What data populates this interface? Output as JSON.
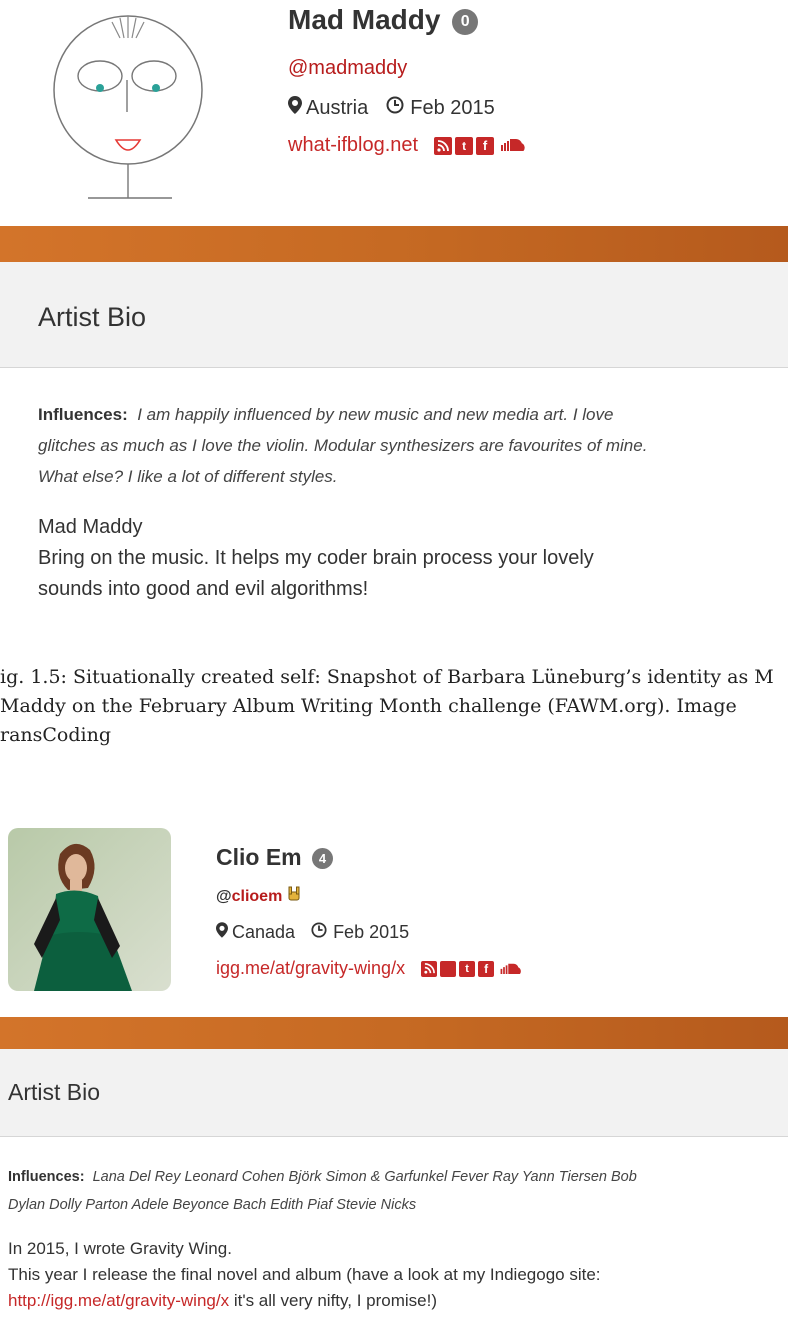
{
  "profile1": {
    "name": "Mad Maddy",
    "badge": "0",
    "handle": "@madmaddy",
    "location": "Austria",
    "joined": "Feb 2015",
    "website": "what-ifblog.net",
    "social_icons": [
      "rss-icon",
      "twitter-icon",
      "facebook-icon",
      "soundcloud-icon"
    ]
  },
  "bio1": {
    "heading": "Artist Bio",
    "influences_label": "Influences:",
    "influences_line1": "I am happily influenced by new music and new media art. I love",
    "influences_line2": "glitches as much as I love the violin. Modular synthesizers are favourites of mine.",
    "influences_line3": "What else? I like a lot of different styles.",
    "text_line1": "Mad Maddy",
    "text_line2": "Bring on the music. It helps my coder brain process your lovely",
    "text_line3": "sounds into good and evil algorithms!"
  },
  "caption": {
    "line1": "ig. 1.5: Situationally created self: Snapshot of Barbara Lüneburg’s identity as M",
    "line2": "Maddy on the February Album Writing Month challenge (FAWM.org). Image",
    "line3": "ransCoding"
  },
  "profile2": {
    "name": "Clio Em",
    "badge": "4",
    "handle_prefix": "@",
    "handle": "clioem",
    "location": "Canada",
    "joined": "Feb 2015",
    "website": "igg.me/at/gravity-wing/x",
    "social_icons": [
      "rss-icon",
      "square-icon",
      "twitter-icon",
      "facebook-icon",
      "soundcloud-icon"
    ]
  },
  "bio2": {
    "heading": "Artist Bio",
    "influences_label": "Influences:",
    "influences_line1": "Lana Del Rey Leonard Cohen Björk Simon & Garfunkel Fever Ray Yann Tiersen Bob",
    "influences_line2": "Dylan Dolly Parton Adele Beyonce Bach Edith Piaf Stevie Nicks",
    "text_line1": "In 2015, I wrote Gravity Wing.",
    "text_line2": "This year I release the final novel and album (have a look at my Indiegogo site:",
    "text_link": "http://igg.me/at/gravity-wing/x",
    "text_after_link": " it's all very nifty, I promise!)"
  },
  "colors": {
    "accent_red": "#c62828",
    "orange_band": "#c66a23",
    "badge_gray": "#777777"
  }
}
